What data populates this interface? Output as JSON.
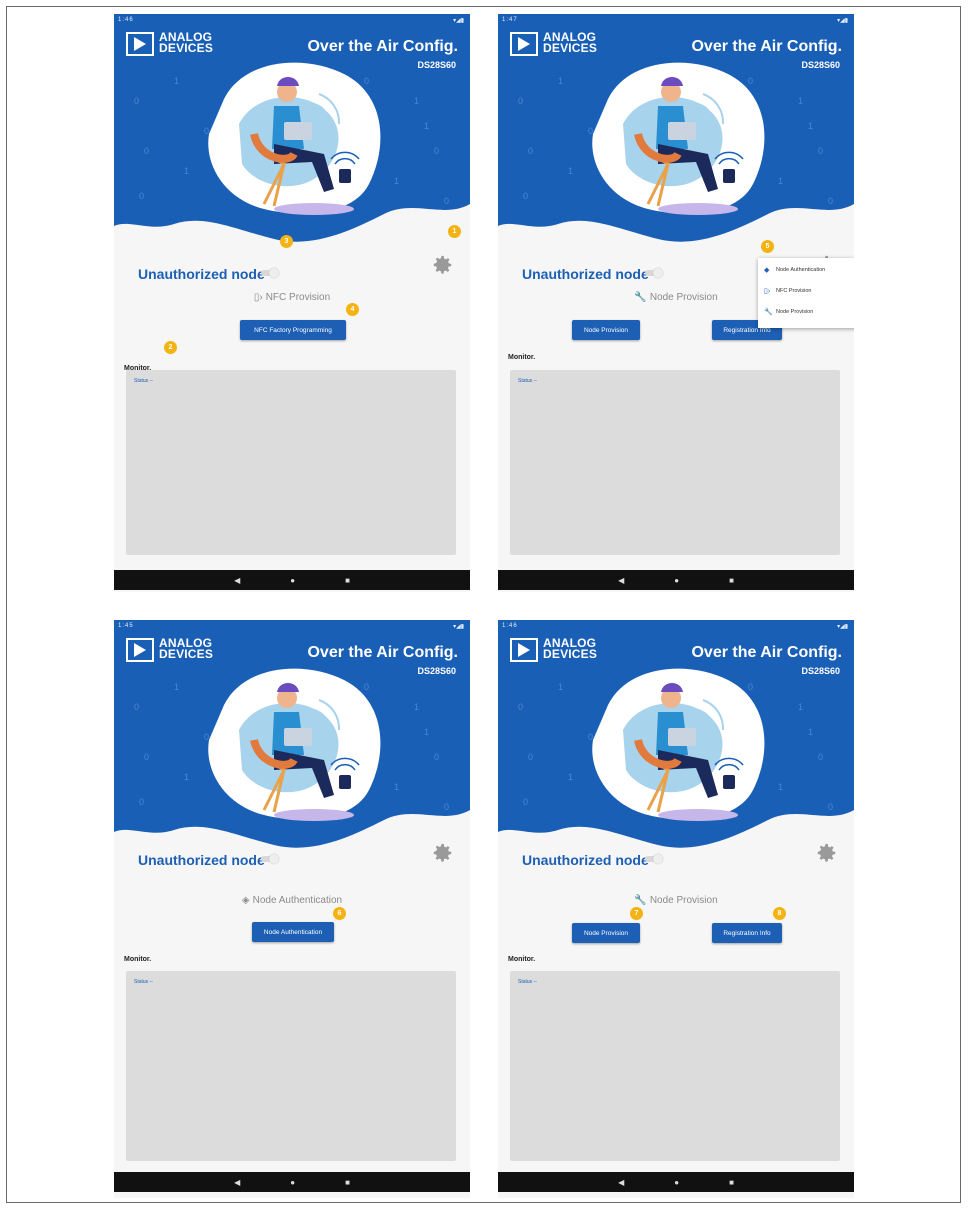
{
  "brand": {
    "line1": "ANALOG",
    "line2": "DEVICES"
  },
  "app": {
    "title": "Over the Air Config.",
    "subtitle": "DS28S60"
  },
  "colors": {
    "primary": "#1c5fb5",
    "badge": "#f5b312",
    "hero": "#1a5fb6"
  },
  "node_status": "Unauthorized node",
  "monitor_label": "Monitor.",
  "status_text": "Status --",
  "screens": [
    {
      "status_time": "1:46",
      "section_icon": "nfc-icon",
      "section_glyph": "▯›",
      "section_label": "NFC Provision",
      "buttons": [
        "NFC Factory Programming"
      ],
      "badges": [
        "1",
        "2",
        "3",
        "4"
      ]
    },
    {
      "status_time": "1:47",
      "section_icon": "wrench-icon",
      "section_glyph": "🔧",
      "section_label": "Node Provision",
      "buttons": [
        "Node Provision",
        "Registration Info"
      ],
      "badges": [
        "5"
      ],
      "menu": {
        "items": [
          {
            "icon": "shield-icon",
            "glyph": "◆",
            "label": "Node Authentication"
          },
          {
            "icon": "nfc-icon",
            "glyph": "▯›",
            "label": "NFC Provision"
          },
          {
            "icon": "wrench-icon",
            "glyph": "🔧",
            "label": "Node Provision"
          }
        ]
      }
    },
    {
      "status_time": "1:45",
      "section_icon": "shield-icon",
      "section_glyph": "◈",
      "section_label": "Node Authentication",
      "buttons": [
        "Node Authentication"
      ],
      "badges": [
        "6"
      ]
    },
    {
      "status_time": "1:46",
      "section_icon": "wrench-icon",
      "section_glyph": "🔧",
      "section_label": "Node Provision",
      "buttons": [
        "Node Provision",
        "Registration Info"
      ],
      "badges": [
        "7",
        "8"
      ]
    }
  ],
  "navbar": {
    "back": "◀",
    "home": "●",
    "recents": "■"
  }
}
